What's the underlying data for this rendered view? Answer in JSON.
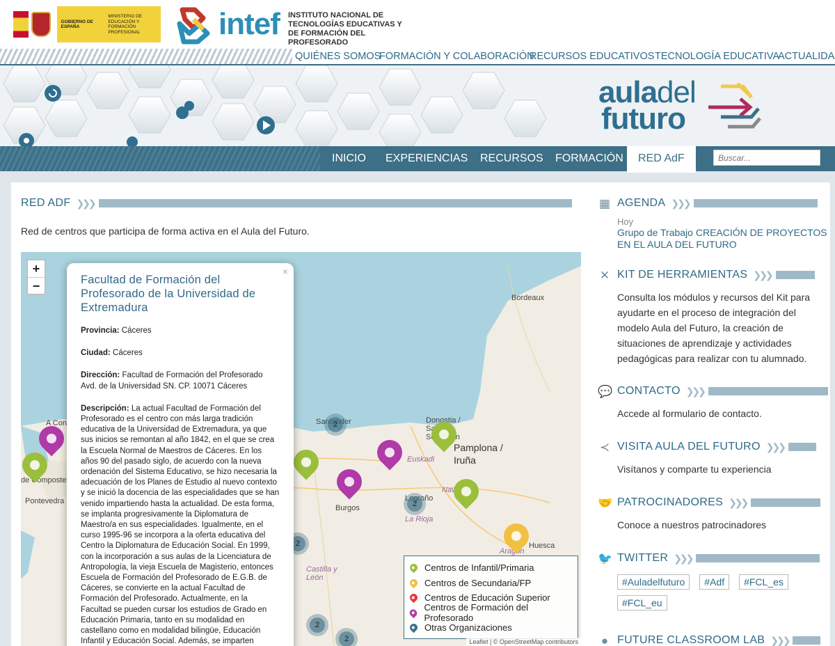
{
  "header": {
    "gov_line1": "Gobierno de España",
    "gov_line2": "Ministerio de Educación y Formación Profesional",
    "intef_word": "intef",
    "intef_sub": "Instituto Nacional de Tecnologías Educativas y de Formación del Profesorado"
  },
  "top_nav": [
    "QUIÉNES SOMOS",
    "FORMACIÓN Y COLABORACIÓN",
    "RECURSOS EDUCATIVOS",
    "TECNOLOGÍA EDUCATIVA",
    "ACTUALIDAD"
  ],
  "banner": {
    "logo_line1a": "aula",
    "logo_line1b": "del",
    "logo_line2": "futuro"
  },
  "main_nav": [
    "INICIO",
    "EXPERIENCIAS",
    "RECURSOS",
    "FORMACIÓN",
    "RED AdF"
  ],
  "search": {
    "placeholder": "Buscar..."
  },
  "page": {
    "title": "RED ADF",
    "intro": "Red de centros que participa de forma activa en el Aula del Futuro."
  },
  "map": {
    "zoom_in": "+",
    "zoom_out": "−",
    "places": [
      "Bordeaux",
      "Santander",
      "Donostia / San Sebastián",
      "Euskadi",
      "Pamplona / Iruña",
      "Navarra",
      "Burgos",
      "Logroño",
      "La Rioja",
      "Castilla y León",
      "Aragón",
      "Huesca",
      "de Compostela",
      "Pontevedra",
      "A Coruña"
    ],
    "clusters": [
      "2",
      "2",
      "2",
      "2",
      "2"
    ],
    "legend": [
      {
        "label": "Centros de Infantil/Primaria",
        "color": "#9bbf3c"
      },
      {
        "label": "Centros de Secundaria/FP",
        "color": "#f0c040"
      },
      {
        "label": "Centros de Educación Superior",
        "color": "#e23b3b"
      },
      {
        "label": "Centros de Formación del Profesorado",
        "color": "#b03aa8"
      },
      {
        "label": "Otras Organizaciones",
        "color": "#3d6f86"
      }
    ],
    "attribution": "Leaflet | © OpenStreetMap contributors"
  },
  "popup": {
    "close": "×",
    "title": "Facultad de Formación del Profesorado de la Universidad de Extremadura",
    "provincia_label": "Provincia",
    "provincia": "Cáceres",
    "ciudad_label": "Ciudad",
    "ciudad": "Cáceres",
    "direccion_label": "Dirección",
    "direccion": "Facultad de Formación del Profesorado Avd. de la Universidad SN. CP. 10071 Cáceres",
    "descripcion_label": "Descripción",
    "descripcion": "La actual Facultad de Formación del Profesorado es el centro con más larga tradición educativa de la Universidad de Extremadura, ya que sus inicios se remontan al año 1842, en el que se crea la Escuela Normal de Maestros de Cáceres. En los años 90 del pasado siglo, de acuerdo con la nueva ordenación del Sistema Educativo, se hizo necesaria la adecuación de los Planes de Estudio al nuevo contexto y se inició la docencia de las especialidades que se han venido impartiendo hasta la actualidad. De esta forma, se implanta progresivamente la Diplomatura de Maestro/a en sus especialidades. Igualmente, en el curso 1995-96 se incorpora a la oferta educativa del Centro la Diplomatura de Educación Social. En 1999, con la incorporación a sus aulas de la Licenciatura de Antropología, la vieja Escuela de Magisterio, entonces Escuela de Formación del Profesorado de E.G.B. de Cáceres, se convierte en la actual Facultad de Formación del Profesorado. Actualmente, en la Facultad se pueden cursar los estudios de Grado en Educación Primaria, tanto en su modalidad en castellano como en modalidad bilingüe, Educación Infantil y Educación Social. Además, se imparten estudios de postgrado"
  },
  "sidebar": {
    "agenda": {
      "title": "AGENDA",
      "date": "Hoy",
      "event": "Grupo de Trabajo CREACIÓN DE PROYECTOS EN EL AULA DEL FUTURO"
    },
    "kit": {
      "title": "KIT DE HERRAMIENTAS",
      "text": "Consulta los módulos y recursos del Kit para ayudarte en el proceso de integración del modelo Aula del Futuro, la creación de situaciones de aprendizaje y actividades pedagógicas para realizar con tu alumnado."
    },
    "contacto": {
      "title": "CONTACTO",
      "text": "Accede al formulario de contacto."
    },
    "visita": {
      "title": "VISITA AULA DEL FUTURO",
      "text": "Visítanos y comparte tu experiencia"
    },
    "patrocinadores": {
      "title": "PATROCINADORES",
      "text": "Conoce a nuestros patrocinadores"
    },
    "twitter": {
      "title": "TWITTER",
      "tags": [
        "#Auladelfuturo",
        "#Adf",
        "#FCL_es",
        "#FCL_eu"
      ]
    },
    "fcl": {
      "title": "FUTURE CLASSROOM LAB"
    }
  },
  "colors": {
    "brand": "#3d6f86",
    "link": "#2f6a88",
    "accent_bar": "#9fb9c7"
  }
}
